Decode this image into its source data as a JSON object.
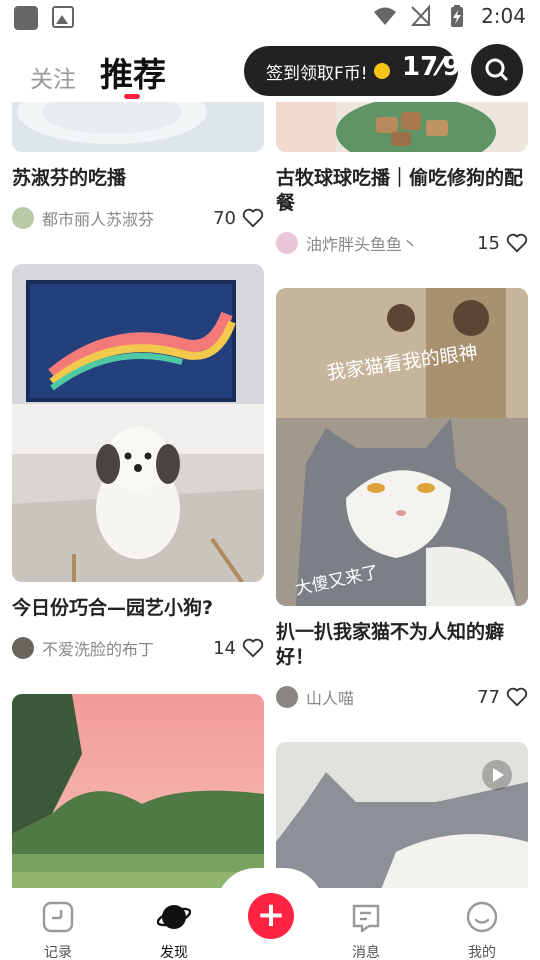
{
  "status_bar": {
    "time": "2:04"
  },
  "header": {
    "tab_follow": "关注",
    "tab_recommend": "推荐",
    "signin_text": "签到领取F币!",
    "signin_count": "17⁄9"
  },
  "cards": [
    {
      "title": "苏淑芬的吃播",
      "author": "都市丽人苏淑芬",
      "likes": "70"
    },
    {
      "title": "古牧球球吃播｜偷吃修狗的配餐",
      "author": "油炸胖头鱼鱼丶",
      "likes": "15"
    },
    {
      "title": "今日份巧合—园艺小狗?",
      "author": "不爱洗脸的布丁",
      "likes": "14"
    },
    {
      "title": "扒一扒我家猫不为人知的癖好！",
      "author": "山人喵",
      "likes": "77",
      "image_text_top": "我家猫看我的眼神",
      "image_text_bottom": "大傻又来了"
    },
    {
      "title": "",
      "author": "",
      "likes": ""
    },
    {
      "title": "",
      "author": "",
      "likes": ""
    }
  ],
  "bottom_nav": {
    "items": [
      {
        "label": "记录"
      },
      {
        "label": "发现"
      },
      {
        "label": "消息"
      },
      {
        "label": "我的"
      }
    ],
    "fab": "+"
  },
  "colors": {
    "accent": "#ff2442",
    "dark": "#222222"
  }
}
